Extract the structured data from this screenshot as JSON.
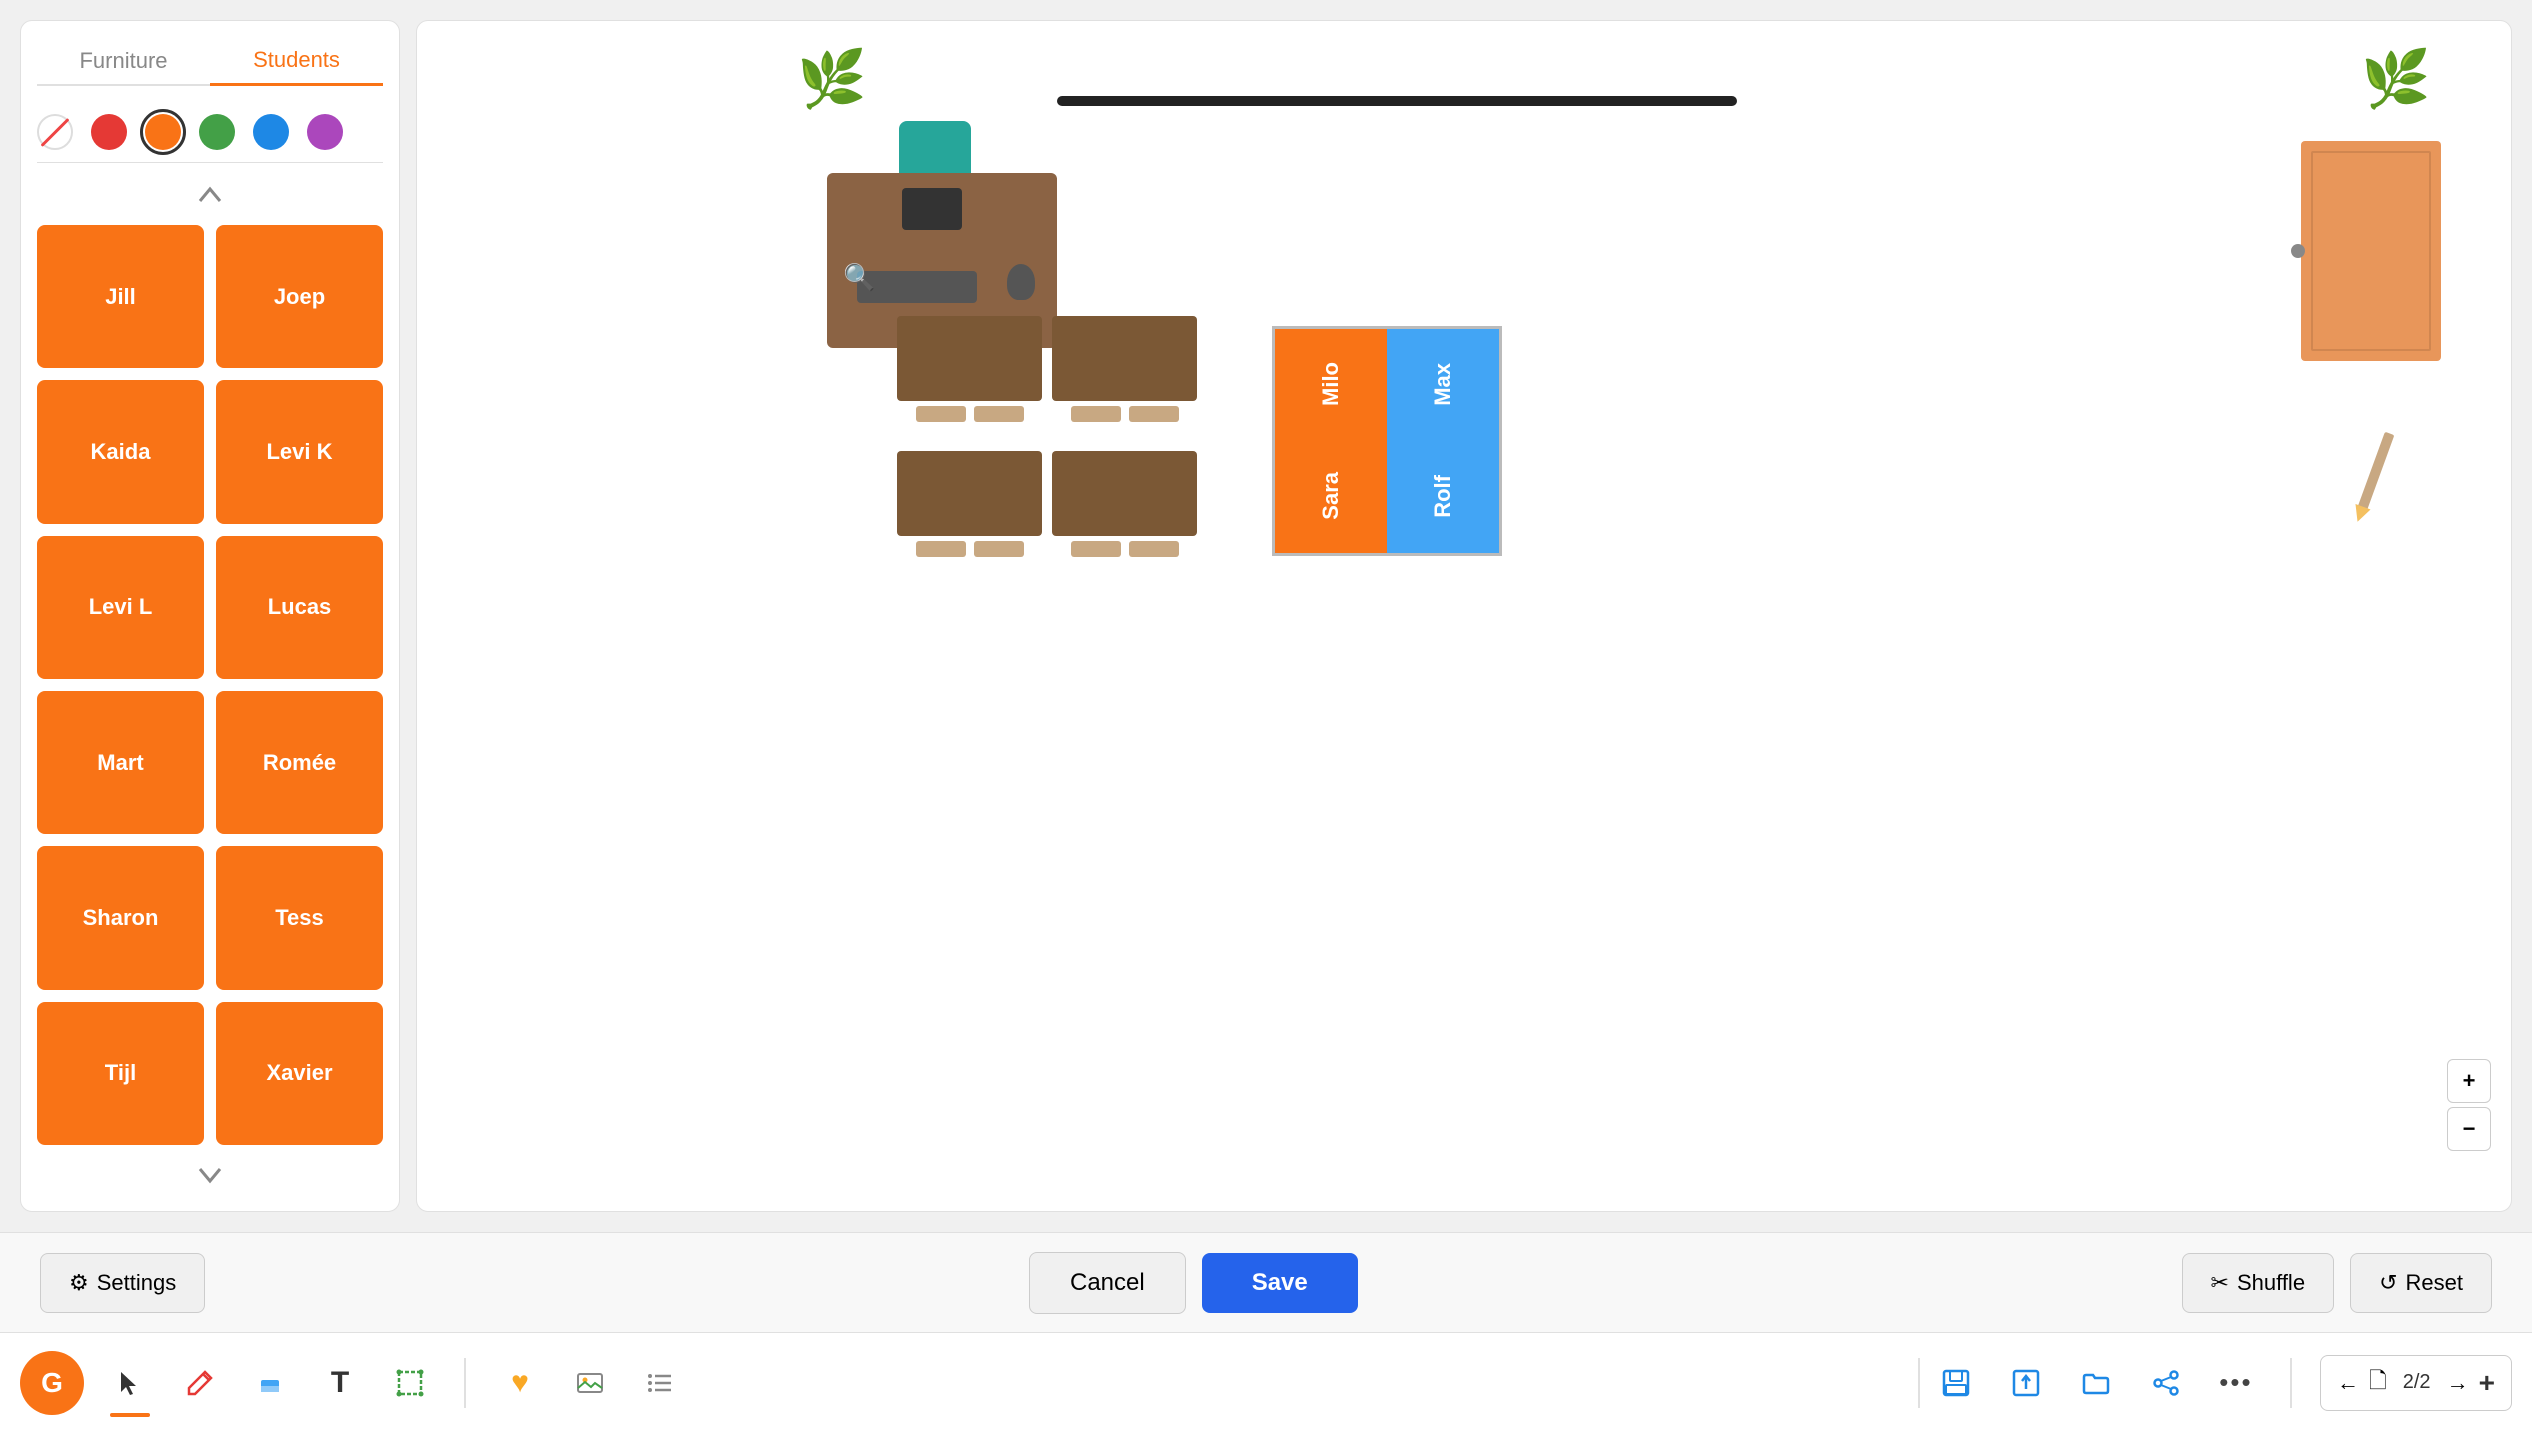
{
  "tabs": {
    "furniture": "Furniture",
    "students": "Students"
  },
  "colors": [
    {
      "name": "none",
      "value": "none"
    },
    {
      "name": "red",
      "value": "#e53935"
    },
    {
      "name": "orange",
      "value": "#f97316"
    },
    {
      "name": "green",
      "value": "#43a047"
    },
    {
      "name": "blue",
      "value": "#1e88e5"
    },
    {
      "name": "purple",
      "value": "#ab47bc"
    }
  ],
  "students": [
    {
      "id": "jill",
      "name": "Jill"
    },
    {
      "id": "joep",
      "name": "Joep"
    },
    {
      "id": "kaida",
      "name": "Kaida"
    },
    {
      "id": "levi-k",
      "name": "Levi K"
    },
    {
      "id": "levi-l",
      "name": "Levi L"
    },
    {
      "id": "lucas",
      "name": "Lucas"
    },
    {
      "id": "mart",
      "name": "Mart"
    },
    {
      "id": "romee",
      "name": "Romée"
    },
    {
      "id": "sharon",
      "name": "Sharon"
    },
    {
      "id": "tess",
      "name": "Tess"
    },
    {
      "id": "tijl",
      "name": "Tijl"
    },
    {
      "id": "xavier",
      "name": "Xavier"
    }
  ],
  "seating": [
    {
      "name": "Milo",
      "color": "orange"
    },
    {
      "name": "Max",
      "color": "blue"
    },
    {
      "name": "Sara",
      "color": "orange"
    },
    {
      "name": "Rolf",
      "color": "blue"
    }
  ],
  "actions": {
    "settings": "Settings",
    "cancel": "Cancel",
    "save": "Save",
    "shuffle": "Shuffle",
    "reset": "Reset"
  },
  "toolbar": {
    "logo": "G",
    "page_current": "2",
    "page_total": "2",
    "page_label": "2/2"
  },
  "zoom": {
    "plus": "+",
    "minus": "−"
  }
}
